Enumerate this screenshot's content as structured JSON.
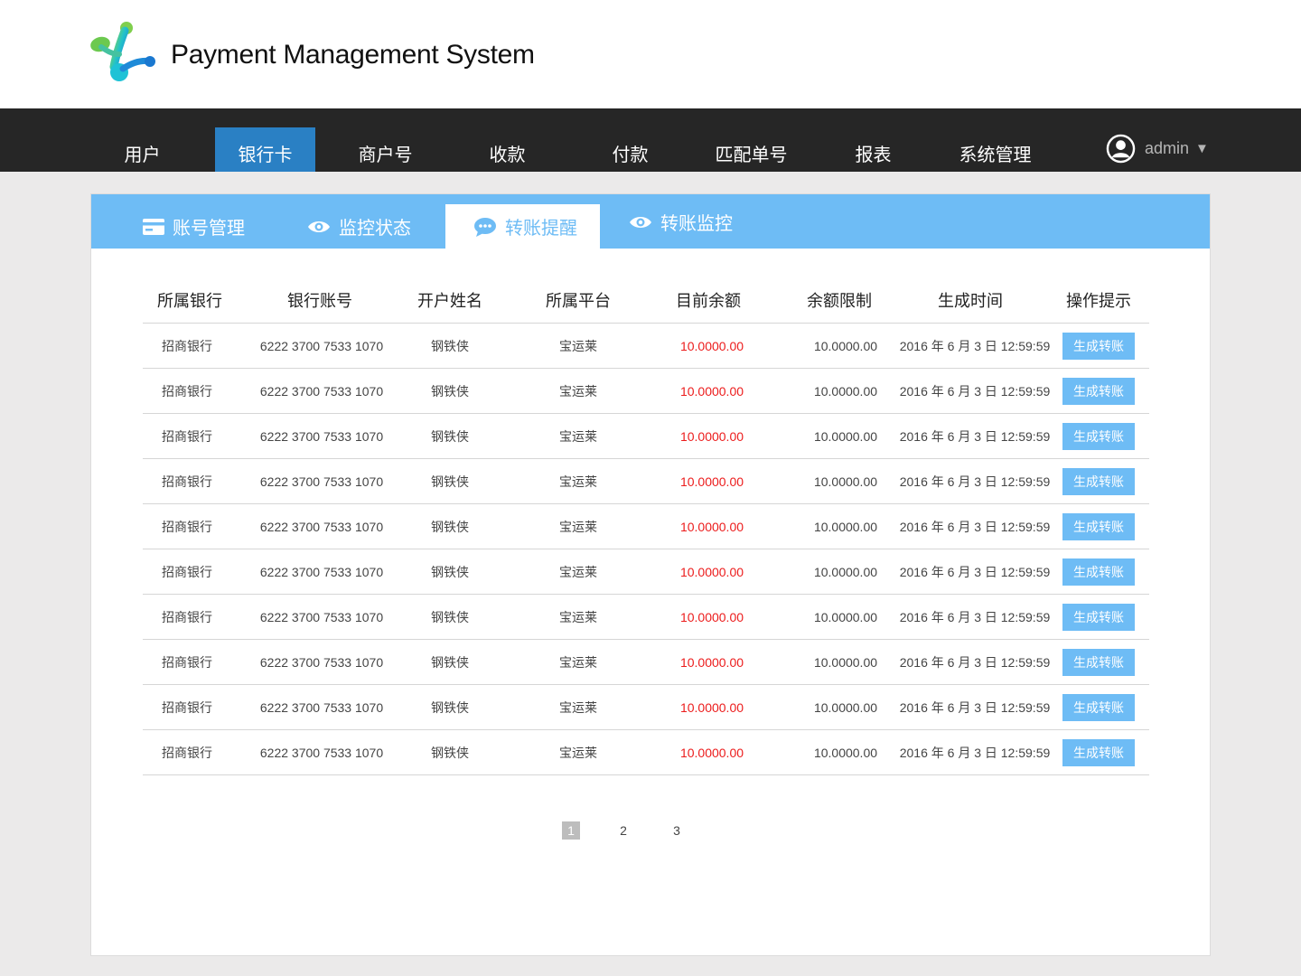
{
  "header": {
    "title": "Payment Management System"
  },
  "nav": {
    "items": [
      {
        "label": "用户",
        "active": false
      },
      {
        "label": "银行卡",
        "active": true
      },
      {
        "label": "商户号",
        "active": false
      },
      {
        "label": "收款",
        "active": false
      },
      {
        "label": "付款",
        "active": false
      },
      {
        "label": "匹配单号",
        "active": false
      },
      {
        "label": "报表",
        "active": false
      },
      {
        "label": "系统管理",
        "active": false
      }
    ],
    "user": {
      "name": "admin",
      "caret": "▼"
    }
  },
  "tabs": [
    {
      "label": "账号管理",
      "icon": "card-icon",
      "active": false
    },
    {
      "label": "监控状态",
      "icon": "eye-icon",
      "active": false
    },
    {
      "label": "转账提醒",
      "icon": "chat-icon",
      "active": true
    },
    {
      "label": "转账监控",
      "icon": "eye-icon",
      "active": false
    }
  ],
  "table": {
    "columns": [
      "所属银行",
      "银行账号",
      "开户姓名",
      "所属平台",
      "目前余额",
      "余额限制",
      "生成时间",
      "操作提示"
    ],
    "rows": [
      {
        "bank": "招商银行",
        "account": "6222 3700 7533 1070",
        "name": "钢铁侠",
        "platform": "宝运莱",
        "balance": "10.0000.00",
        "limit": "10.0000.00",
        "time": "2016 年 6 月 3 日 12:59:59",
        "action": "生成转账"
      },
      {
        "bank": "招商银行",
        "account": "6222 3700 7533 1070",
        "name": "钢铁侠",
        "platform": "宝运莱",
        "balance": "10.0000.00",
        "limit": "10.0000.00",
        "time": "2016 年 6 月 3 日 12:59:59",
        "action": "生成转账"
      },
      {
        "bank": "招商银行",
        "account": "6222 3700 7533 1070",
        "name": "钢铁侠",
        "platform": "宝运莱",
        "balance": "10.0000.00",
        "limit": "10.0000.00",
        "time": "2016 年 6 月 3 日 12:59:59",
        "action": "生成转账"
      },
      {
        "bank": "招商银行",
        "account": "6222 3700 7533 1070",
        "name": "钢铁侠",
        "platform": "宝运莱",
        "balance": "10.0000.00",
        "limit": "10.0000.00",
        "time": "2016 年 6 月 3 日 12:59:59",
        "action": "生成转账"
      },
      {
        "bank": "招商银行",
        "account": "6222 3700 7533 1070",
        "name": "钢铁侠",
        "platform": "宝运莱",
        "balance": "10.0000.00",
        "limit": "10.0000.00",
        "time": "2016 年 6 月 3 日 12:59:59",
        "action": "生成转账"
      },
      {
        "bank": "招商银行",
        "account": "6222 3700 7533 1070",
        "name": "钢铁侠",
        "platform": "宝运莱",
        "balance": "10.0000.00",
        "limit": "10.0000.00",
        "time": "2016 年 6 月 3 日 12:59:59",
        "action": "生成转账"
      },
      {
        "bank": "招商银行",
        "account": "6222 3700 7533 1070",
        "name": "钢铁侠",
        "platform": "宝运莱",
        "balance": "10.0000.00",
        "limit": "10.0000.00",
        "time": "2016 年 6 月 3 日 12:59:59",
        "action": "生成转账"
      },
      {
        "bank": "招商银行",
        "account": "6222 3700 7533 1070",
        "name": "钢铁侠",
        "platform": "宝运莱",
        "balance": "10.0000.00",
        "limit": "10.0000.00",
        "time": "2016 年 6 月 3 日 12:59:59",
        "action": "生成转账"
      },
      {
        "bank": "招商银行",
        "account": "6222 3700 7533 1070",
        "name": "钢铁侠",
        "platform": "宝运莱",
        "balance": "10.0000.00",
        "limit": "10.0000.00",
        "time": "2016 年 6 月 3 日 12:59:59",
        "action": "生成转账"
      },
      {
        "bank": "招商银行",
        "account": "6222 3700 7533 1070",
        "name": "钢铁侠",
        "platform": "宝运莱",
        "balance": "10.0000.00",
        "limit": "10.0000.00",
        "time": "2016 年 6 月 3 日 12:59:59",
        "action": "生成转账"
      }
    ]
  },
  "pagination": {
    "pages": [
      {
        "label": "1",
        "active": true
      },
      {
        "label": "2",
        "active": false
      },
      {
        "label": "3",
        "active": false
      }
    ]
  },
  "colors": {
    "nav_bg": "#262626",
    "nav_active": "#2a80c4",
    "tab_bar": "#6ebcf5",
    "button": "#6ebcf5",
    "balance_red": "#ec1c1c",
    "page_bg": "#ebeaea"
  }
}
